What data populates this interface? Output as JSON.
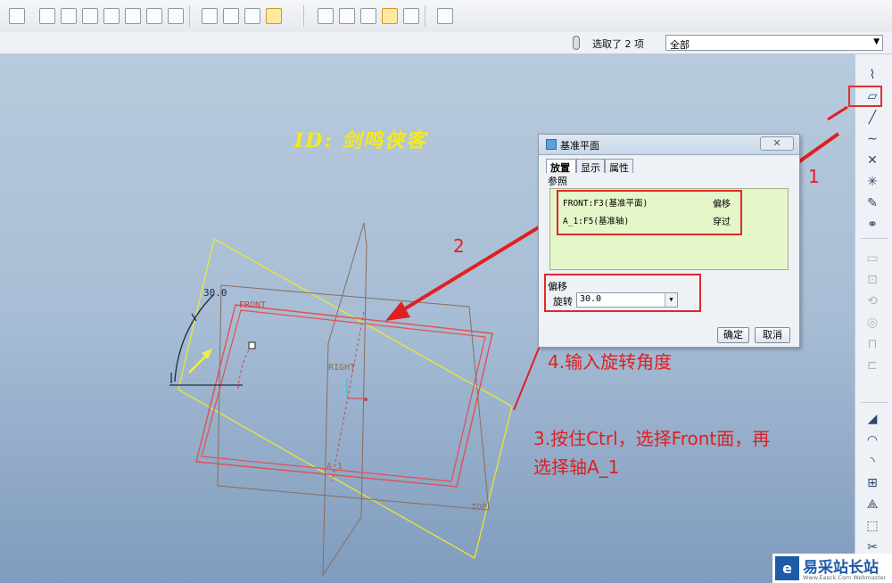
{
  "toolbar": {
    "buttons": [
      "view-style-icon",
      "zoom-in-icon",
      "zoom-out-icon",
      "refit-icon",
      "reorient-icon",
      "saved-views-icon",
      "layers-icon",
      "render-icon",
      "wireframe-icon",
      "hidden-line-icon",
      "no-hidden-icon",
      "shading-icon",
      "plane-display-icon",
      "axis-display-icon",
      "point-display-icon",
      "csys-display-icon",
      "annotation-display-icon",
      "whats-this-icon"
    ]
  },
  "status": {
    "selection_count": "选取了 2 项",
    "filter_value": "全部"
  },
  "watermark": "ID: 剑鸣侠客",
  "right_toolbar": {
    "items": [
      "analysis-icon",
      "datum-plane-icon",
      "datum-axis-icon",
      "datum-curve-icon",
      "datum-point-icon",
      "csys-icon",
      "sketch-icon",
      "curve-from-equation-icon",
      "extrude-icon",
      "revolve-icon",
      "sweep-icon",
      "hole-icon",
      "shell-icon",
      "rib-icon",
      "draft-icon",
      "round-icon",
      "chamfer-icon",
      "pattern-icon",
      "mirror-icon",
      "merge-icon",
      "trim-icon",
      "offset-icon"
    ]
  },
  "dialog": {
    "title": "基准平面",
    "close_glyph": "✕",
    "tabs": [
      "放置",
      "显示",
      "属性"
    ],
    "references_label": "参照",
    "references": [
      {
        "item": "FRONT:F3(基准平面)",
        "constraint": "偏移"
      },
      {
        "item": "A_1:F5(基准轴)",
        "constraint": "穿过"
      }
    ],
    "offset_label": "偏移",
    "rotation_label": "旋转",
    "rotation_value": "30.0",
    "ok_label": "确定",
    "cancel_label": "取消"
  },
  "scene_labels": {
    "angle": "30.0",
    "front": "FRONT",
    "right": "RIGHT",
    "axis": "A_1",
    "top": "TOP"
  },
  "annotations": {
    "step1": "1",
    "step2": "2",
    "step3_line1": "3.按住Ctrl，选择Front面，再",
    "step3_line2": "选择轴A_1",
    "step4": "4.输入旋转角度"
  },
  "brand": {
    "name": "易采站长站",
    "url": "Www.Easck.Com Webmaster"
  },
  "colors": {
    "annotation": "#e02020",
    "datum_plane": "#e05050",
    "new_plane": "#e8e832",
    "watermark": "#f5ea18"
  }
}
